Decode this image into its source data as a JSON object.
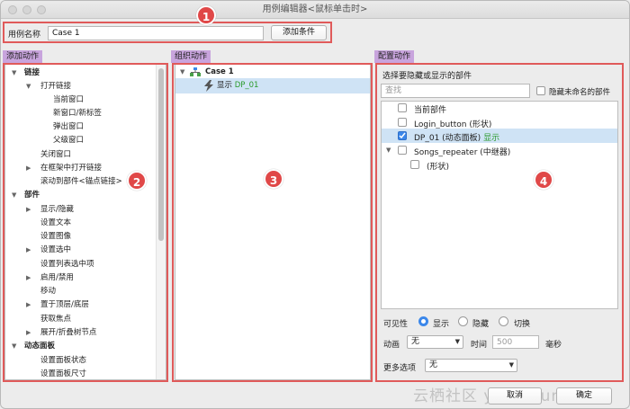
{
  "window": {
    "title": "用例编辑器<鼠标单击时>"
  },
  "header": {
    "name_label": "用例名称",
    "name_value": "Case 1",
    "add_condition_button": "添加条件"
  },
  "markers": [
    "1",
    "2",
    "3",
    "4"
  ],
  "sections": {
    "add_action": "添加动作",
    "organize_action": "组织动作",
    "configure_action": "配置动作"
  },
  "add_action_tree": {
    "link": "链接",
    "open_link": "打开链接",
    "current_window": "当前窗口",
    "new_window_tab": "新窗口/新标签",
    "popup_window": "弹出窗口",
    "parent_window": "父级窗口",
    "close_window": "关闭窗口",
    "open_in_frame": "在框架中打开链接",
    "scroll_to_widget": "滚动到部件<锚点链接>",
    "widget": "部件",
    "show_hide": "显示/隐藏",
    "set_text": "设置文本",
    "set_image": "设置图像",
    "set_selected": "设置选中",
    "set_list_selected": "设置列表选中项",
    "enable_disable": "启用/禁用",
    "move": "移动",
    "bring_front_back": "置于顶层/底层",
    "focus": "获取焦点",
    "expand_collapse_tree": "展开/折叠树节点",
    "dynamic_panel": "动态面板",
    "set_panel_state": "设置面板状态",
    "set_panel_size": "设置面板尺寸"
  },
  "organize_tree": {
    "case": "Case 1",
    "action_verb": "显示",
    "action_target": "DP_01"
  },
  "configure": {
    "prompt": "选择要隐藏或显示的部件",
    "search_placeholder": "查找",
    "hide_unnamed": "隐藏未命名的部件",
    "items": {
      "current_widget": "当前部件",
      "login_button": "Login_button (形状)",
      "dp01": "DP_01 (动态面板)",
      "dp01_state": "显示",
      "songs_repeater": "Songs_repeater (中继器)",
      "shape": "(形状)"
    },
    "visibility_label": "可见性",
    "visibility_options": {
      "show": "显示",
      "hide": "隐藏",
      "toggle": "切换"
    },
    "animation_label": "动画",
    "animation_value": "无",
    "time_label": "时间",
    "time_placeholder": "500",
    "time_unit": "毫秒",
    "more_options_label": "更多选项",
    "more_options_value": "无"
  },
  "footer": {
    "cancel": "取消",
    "ok": "确定"
  },
  "watermark": "云栖社区 yq.aliyun.com",
  "colors": {
    "annotation_red": "#e04848",
    "section_purple": "#c8a4dd",
    "selection_blue": "#cfe3f5",
    "accent_blue": "#3b87ea",
    "state_green": "#2a9a2a"
  }
}
